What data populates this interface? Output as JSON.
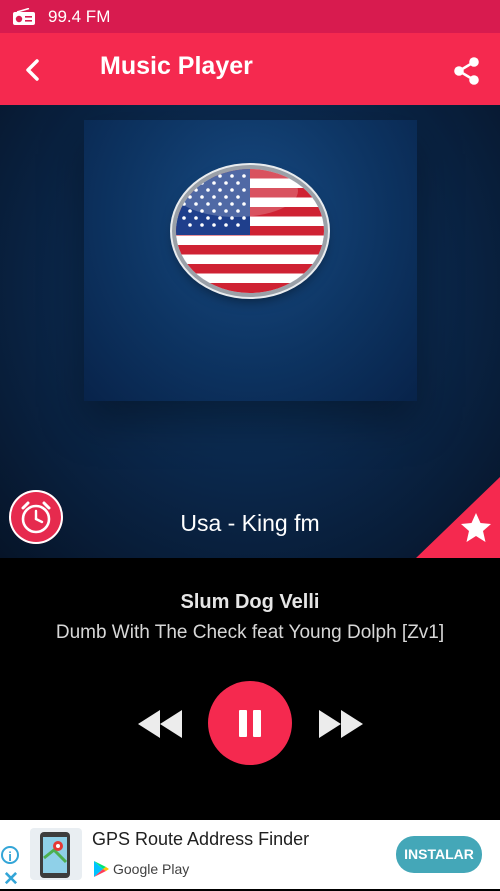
{
  "status_bar": {
    "icon": "radio-icon",
    "text": "99.4 FM"
  },
  "app_bar": {
    "back_icon": "back-arrow-icon",
    "title": "Music Player",
    "share_icon": "share-icon"
  },
  "colors": {
    "accent": "#f5294f",
    "status_bar": "#d81b4f",
    "panel": "#000000"
  },
  "now_playing": {
    "station": "Usa - King fm",
    "artwork_icon": "usa-flag-icon",
    "alarm_icon": "alarm-clock-icon",
    "favorite_icon": "star-icon",
    "artist": "Slum Dog Velli",
    "song": "Dumb With The Check feat Young Dolph [Zv1]"
  },
  "controls": {
    "prev_icon": "rewind-icon",
    "play_icon": "pause-icon",
    "next_icon": "fast-forward-icon"
  },
  "ad": {
    "info_icon": "info-icon",
    "close_icon": "close-icon",
    "title": "GPS Route Address Finder",
    "store_label": "Google Play",
    "button_label": "INSTALAR"
  }
}
